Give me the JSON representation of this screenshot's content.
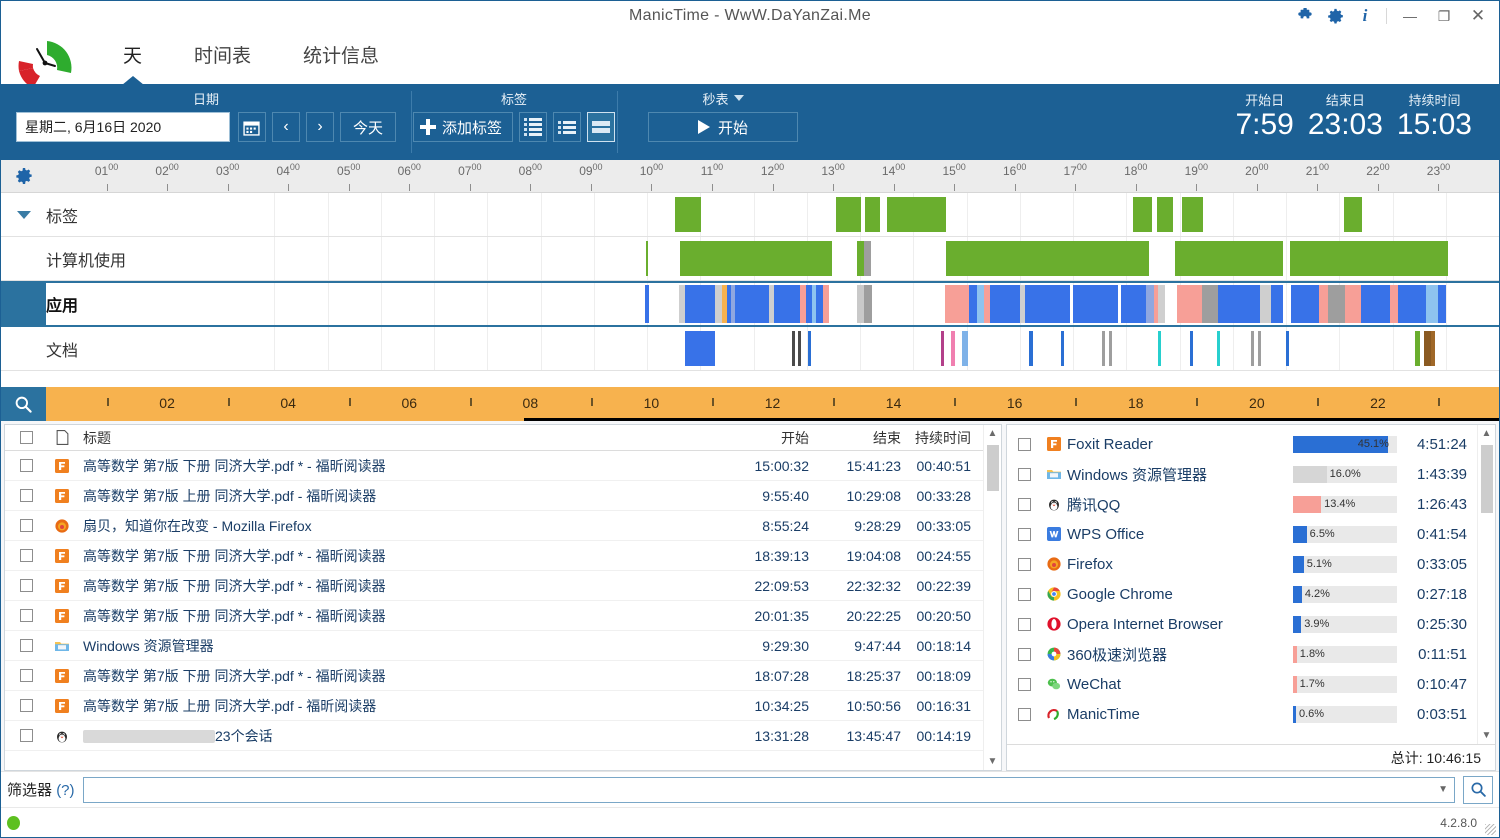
{
  "window": {
    "title": "ManicTime - WwW.DaYanZai.Me",
    "icons": [
      "puzzle-icon",
      "gear-icon",
      "info-icon"
    ],
    "minimize": "—",
    "maximize": "❐",
    "close": "✕"
  },
  "tabs": [
    {
      "label": "天",
      "active": true
    },
    {
      "label": "时间表",
      "active": false
    },
    {
      "label": "统计信息",
      "active": false
    }
  ],
  "ribbon": {
    "date_group": {
      "label": "日期",
      "date_value": "星期二, 6月16日 2020",
      "calendar_icon": "calendar-icon",
      "prev_label": "‹",
      "next_label": "›",
      "today_label": "今天"
    },
    "tag_group": {
      "label": "标签",
      "add_tag_label": "添加标签",
      "view_modes": [
        "list-view-detailed",
        "list-view-compact",
        "list-view-large"
      ],
      "selected_view": 2
    },
    "watch_group": {
      "label": "秒表",
      "start_label": "开始"
    },
    "stats": [
      {
        "label": "开始日",
        "value": "7:59"
      },
      {
        "label": "结束日",
        "value": "23:03"
      },
      {
        "label": "持续时间",
        "value": "15:03"
      }
    ]
  },
  "timeline": {
    "gear_icon": "gear-icon",
    "hour_labels": [
      "01",
      "02",
      "03",
      "04",
      "05",
      "06",
      "07",
      "08",
      "09",
      "10",
      "11",
      "12",
      "13",
      "14",
      "15",
      "16",
      "17",
      "18",
      "19",
      "20",
      "21",
      "22",
      "23"
    ],
    "hour_suffix": "00",
    "tracks": [
      {
        "name": "标签",
        "expandable": true,
        "selected": false,
        "segments": [
          {
            "start": 8.52,
            "end": 9.02,
            "color": "#6aae2e"
          },
          {
            "start": 11.55,
            "end": 12.02,
            "color": "#6aae2e"
          },
          {
            "start": 12.1,
            "end": 12.38,
            "color": "#6aae2e"
          },
          {
            "start": 12.5,
            "end": 13.62,
            "color": "#6aae2e"
          },
          {
            "start": 17.12,
            "end": 17.48,
            "color": "#6aae2e"
          },
          {
            "start": 17.58,
            "end": 17.88,
            "color": "#6aae2e"
          },
          {
            "start": 18.05,
            "end": 18.45,
            "color": "#6aae2e"
          },
          {
            "start": 21.08,
            "end": 21.42,
            "color": "#6aae2e"
          }
        ]
      },
      {
        "name": "计算机使用",
        "expandable": false,
        "selected": false,
        "segments": [
          {
            "start": 7.98,
            "end": 8.02,
            "color": "#6aae2e"
          },
          {
            "start": 8.62,
            "end": 11.48,
            "color": "#6aae2e"
          },
          {
            "start": 11.95,
            "end": 12.08,
            "color": "#6aae2e"
          },
          {
            "start": 12.08,
            "end": 12.2,
            "color": "#9e9e9e"
          },
          {
            "start": 13.62,
            "end": 17.42,
            "color": "#6aae2e"
          },
          {
            "start": 17.92,
            "end": 19.95,
            "color": "#6aae2e"
          },
          {
            "start": 20.08,
            "end": 23.05,
            "color": "#6aae2e"
          }
        ]
      },
      {
        "name": "应用",
        "expandable": false,
        "selected": true,
        "segments": [
          {
            "start": 7.96,
            "end": 8.04,
            "color": "#3872e8"
          },
          {
            "start": 8.6,
            "end": 8.72,
            "color": "#cfcfcf"
          },
          {
            "start": 8.72,
            "end": 9.28,
            "color": "#3872e8"
          },
          {
            "start": 9.28,
            "end": 9.4,
            "color": "#cfcfcf"
          },
          {
            "start": 9.4,
            "end": 9.5,
            "color": "#f7b24e"
          },
          {
            "start": 9.5,
            "end": 9.58,
            "color": "#3872e8"
          },
          {
            "start": 9.58,
            "end": 9.66,
            "color": "#8fa7e0"
          },
          {
            "start": 9.66,
            "end": 10.3,
            "color": "#3872e8"
          },
          {
            "start": 10.3,
            "end": 10.38,
            "color": "#cfcfcf"
          },
          {
            "start": 10.38,
            "end": 10.88,
            "color": "#3872e8"
          },
          {
            "start": 10.88,
            "end": 10.98,
            "color": "#f79f97"
          },
          {
            "start": 10.98,
            "end": 11.1,
            "color": "#3872e8"
          },
          {
            "start": 11.1,
            "end": 11.18,
            "color": "#8ec3ef"
          },
          {
            "start": 11.18,
            "end": 11.3,
            "color": "#3872e8"
          },
          {
            "start": 11.3,
            "end": 11.42,
            "color": "#f79f97"
          },
          {
            "start": 11.95,
            "end": 12.08,
            "color": "#c9c9c9"
          },
          {
            "start": 12.08,
            "end": 12.22,
            "color": "#9e9e9e"
          },
          {
            "start": 13.6,
            "end": 14.05,
            "color": "#f79f97"
          },
          {
            "start": 14.05,
            "end": 14.2,
            "color": "#3872e8"
          },
          {
            "start": 14.2,
            "end": 14.32,
            "color": "#8ec3ef"
          },
          {
            "start": 14.32,
            "end": 14.45,
            "color": "#f79f97"
          },
          {
            "start": 14.45,
            "end": 15.0,
            "color": "#3872e8"
          },
          {
            "start": 15.0,
            "end": 15.1,
            "color": "#cfcfcf"
          },
          {
            "start": 15.1,
            "end": 15.95,
            "color": "#3872e8"
          },
          {
            "start": 16.0,
            "end": 16.85,
            "color": "#3872e8"
          },
          {
            "start": 16.9,
            "end": 17.38,
            "color": "#3872e8"
          },
          {
            "start": 17.38,
            "end": 17.52,
            "color": "#8fa7e0"
          },
          {
            "start": 17.52,
            "end": 17.6,
            "color": "#f79f97"
          },
          {
            "start": 17.6,
            "end": 17.72,
            "color": "#cfcfcf"
          },
          {
            "start": 17.95,
            "end": 18.42,
            "color": "#f79f97"
          },
          {
            "start": 18.42,
            "end": 18.72,
            "color": "#9e9e9e"
          },
          {
            "start": 18.72,
            "end": 19.52,
            "color": "#3872e8"
          },
          {
            "start": 19.52,
            "end": 19.72,
            "color": "#cfcfcf"
          },
          {
            "start": 19.72,
            "end": 19.95,
            "color": "#3872e8"
          },
          {
            "start": 20.1,
            "end": 20.62,
            "color": "#3872e8"
          },
          {
            "start": 20.62,
            "end": 20.78,
            "color": "#f79f97"
          },
          {
            "start": 20.78,
            "end": 21.1,
            "color": "#9e9e9e"
          },
          {
            "start": 21.1,
            "end": 21.4,
            "color": "#f79f97"
          },
          {
            "start": 21.4,
            "end": 21.95,
            "color": "#3872e8"
          },
          {
            "start": 21.95,
            "end": 22.1,
            "color": "#f79f97"
          },
          {
            "start": 22.1,
            "end": 22.62,
            "color": "#3872e8"
          },
          {
            "start": 22.62,
            "end": 22.86,
            "color": "#8ec3ef"
          },
          {
            "start": 22.86,
            "end": 23.0,
            "color": "#3872e8"
          }
        ]
      },
      {
        "name": "文档",
        "expandable": false,
        "selected": false,
        "segments": [
          {
            "start": 8.72,
            "end": 9.28,
            "color": "#3872e8"
          },
          {
            "start": 10.72,
            "end": 10.78,
            "color": "#4a4a4a"
          },
          {
            "start": 10.84,
            "end": 10.9,
            "color": "#4a4a4a"
          },
          {
            "start": 11.02,
            "end": 11.08,
            "color": "#2a6fd4"
          },
          {
            "start": 13.52,
            "end": 13.58,
            "color": "#b3408a"
          },
          {
            "start": 13.7,
            "end": 13.78,
            "color": "#f07fb0"
          },
          {
            "start": 13.92,
            "end": 14.02,
            "color": "#7fb2e8"
          },
          {
            "start": 15.18,
            "end": 15.24,
            "color": "#2a6fd4"
          },
          {
            "start": 15.78,
            "end": 15.84,
            "color": "#2a6fd4"
          },
          {
            "start": 16.55,
            "end": 16.6,
            "color": "#9e9e9e"
          },
          {
            "start": 16.68,
            "end": 16.74,
            "color": "#9e9e9e"
          },
          {
            "start": 17.6,
            "end": 17.66,
            "color": "#27cfce"
          },
          {
            "start": 18.2,
            "end": 18.26,
            "color": "#2a6fd4"
          },
          {
            "start": 18.7,
            "end": 18.76,
            "color": "#27cfce"
          },
          {
            "start": 19.35,
            "end": 19.4,
            "color": "#9e9e9e"
          },
          {
            "start": 19.48,
            "end": 19.54,
            "color": "#9e9e9e"
          },
          {
            "start": 20.0,
            "end": 20.05,
            "color": "#2a6fd4"
          },
          {
            "start": 22.42,
            "end": 22.52,
            "color": "#6aae2e"
          },
          {
            "start": 22.6,
            "end": 22.72,
            "color": "#8a5a22"
          },
          {
            "start": 22.72,
            "end": 22.8,
            "color": "#a06828"
          }
        ]
      }
    ]
  },
  "overview": {
    "search_icon": "search-icon",
    "labels": [
      "02",
      "04",
      "06",
      "08",
      "10",
      "12",
      "14",
      "16",
      "18",
      "20",
      "22"
    ],
    "selection_color": "#000000",
    "band_color": "#f7b24e"
  },
  "table": {
    "columns": {
      "checkbox": "",
      "icon": "document-icon",
      "title": "标题",
      "start": "开始",
      "end": "结束",
      "duration": "持续时间"
    },
    "rows": [
      {
        "icon": "foxit-icon",
        "title": "高等数学 第7版 下册 同济大学.pdf * - 福昕阅读器",
        "start": "15:00:32",
        "end": "15:41:23",
        "duration": "00:40:51"
      },
      {
        "icon": "foxit-icon",
        "title": "高等数学 第7版 上册 同济大学.pdf - 福昕阅读器",
        "start": "9:55:40",
        "end": "10:29:08",
        "duration": "00:33:28"
      },
      {
        "icon": "firefox-icon",
        "title": "扇贝，知道你在改变 - Mozilla Firefox",
        "start": "8:55:24",
        "end": "9:28:29",
        "duration": "00:33:05"
      },
      {
        "icon": "foxit-icon",
        "title": "高等数学 第7版 下册 同济大学.pdf * - 福昕阅读器",
        "start": "18:39:13",
        "end": "19:04:08",
        "duration": "00:24:55"
      },
      {
        "icon": "foxit-icon",
        "title": "高等数学 第7版 下册 同济大学.pdf * - 福昕阅读器",
        "start": "22:09:53",
        "end": "22:32:32",
        "duration": "00:22:39"
      },
      {
        "icon": "foxit-icon",
        "title": "高等数学 第7版 下册 同济大学.pdf * - 福昕阅读器",
        "start": "20:01:35",
        "end": "20:22:25",
        "duration": "00:20:50"
      },
      {
        "icon": "explorer-icon",
        "title": "Windows 资源管理器",
        "start": "9:29:30",
        "end": "9:47:44",
        "duration": "00:18:14"
      },
      {
        "icon": "foxit-icon",
        "title": "高等数学 第7版 下册 同济大学.pdf * - 福昕阅读器",
        "start": "18:07:28",
        "end": "18:25:37",
        "duration": "00:18:09"
      },
      {
        "icon": "foxit-icon",
        "title": "高等数学 第7版 上册 同济大学.pdf - 福昕阅读器",
        "start": "10:34:25",
        "end": "10:50:56",
        "duration": "00:16:31"
      },
      {
        "icon": "qq-icon",
        "title": "23个会话",
        "redacted": true,
        "start": "13:31:28",
        "end": "13:45:47",
        "duration": "00:14:19"
      }
    ]
  },
  "apps": {
    "items": [
      {
        "icon": "foxit-icon",
        "name": "Foxit Reader",
        "pct": "45.1%",
        "pct_value": 45.1,
        "color": "#2a6fd4",
        "time": "4:51:24"
      },
      {
        "icon": "explorer-icon",
        "name": "Windows 资源管理器",
        "pct": "16.0%",
        "pct_value": 16.0,
        "color": "#d6d6d6",
        "time": "1:43:39"
      },
      {
        "icon": "qq-icon",
        "name": "腾讯QQ",
        "pct": "13.4%",
        "pct_value": 13.4,
        "color": "#f79f97",
        "time": "1:26:43"
      },
      {
        "icon": "wps-icon",
        "name": "WPS Office",
        "pct": "6.5%",
        "pct_value": 6.5,
        "color": "#2a6fd4",
        "time": "0:41:54"
      },
      {
        "icon": "firefox-icon",
        "name": "Firefox",
        "pct": "5.1%",
        "pct_value": 5.1,
        "color": "#2a6fd4",
        "time": "0:33:05"
      },
      {
        "icon": "chrome-icon",
        "name": "Google Chrome",
        "pct": "4.2%",
        "pct_value": 4.2,
        "color": "#2a6fd4",
        "time": "0:27:18"
      },
      {
        "icon": "opera-icon",
        "name": "Opera Internet Browser",
        "pct": "3.9%",
        "pct_value": 3.9,
        "color": "#2a6fd4",
        "time": "0:25:30"
      },
      {
        "icon": "360-icon",
        "name": "360极速浏览器",
        "pct": "1.8%",
        "pct_value": 1.8,
        "color": "#f79f97",
        "time": "0:11:51"
      },
      {
        "icon": "wechat-icon",
        "name": "WeChat",
        "pct": "1.7%",
        "pct_value": 1.7,
        "color": "#f79f97",
        "time": "0:10:47"
      },
      {
        "icon": "manictime-icon",
        "name": "ManicTime",
        "pct": "0.6%",
        "pct_value": 0.6,
        "color": "#2a6fd4",
        "time": "0:03:51"
      }
    ],
    "total_label": "总计: 10:46:15"
  },
  "filter": {
    "label": "筛选器",
    "help": "(?)",
    "value": "",
    "placeholder": "",
    "search_icon": "search-icon"
  },
  "status": {
    "indicator": "recording-active",
    "version": "4.2.8.0"
  }
}
